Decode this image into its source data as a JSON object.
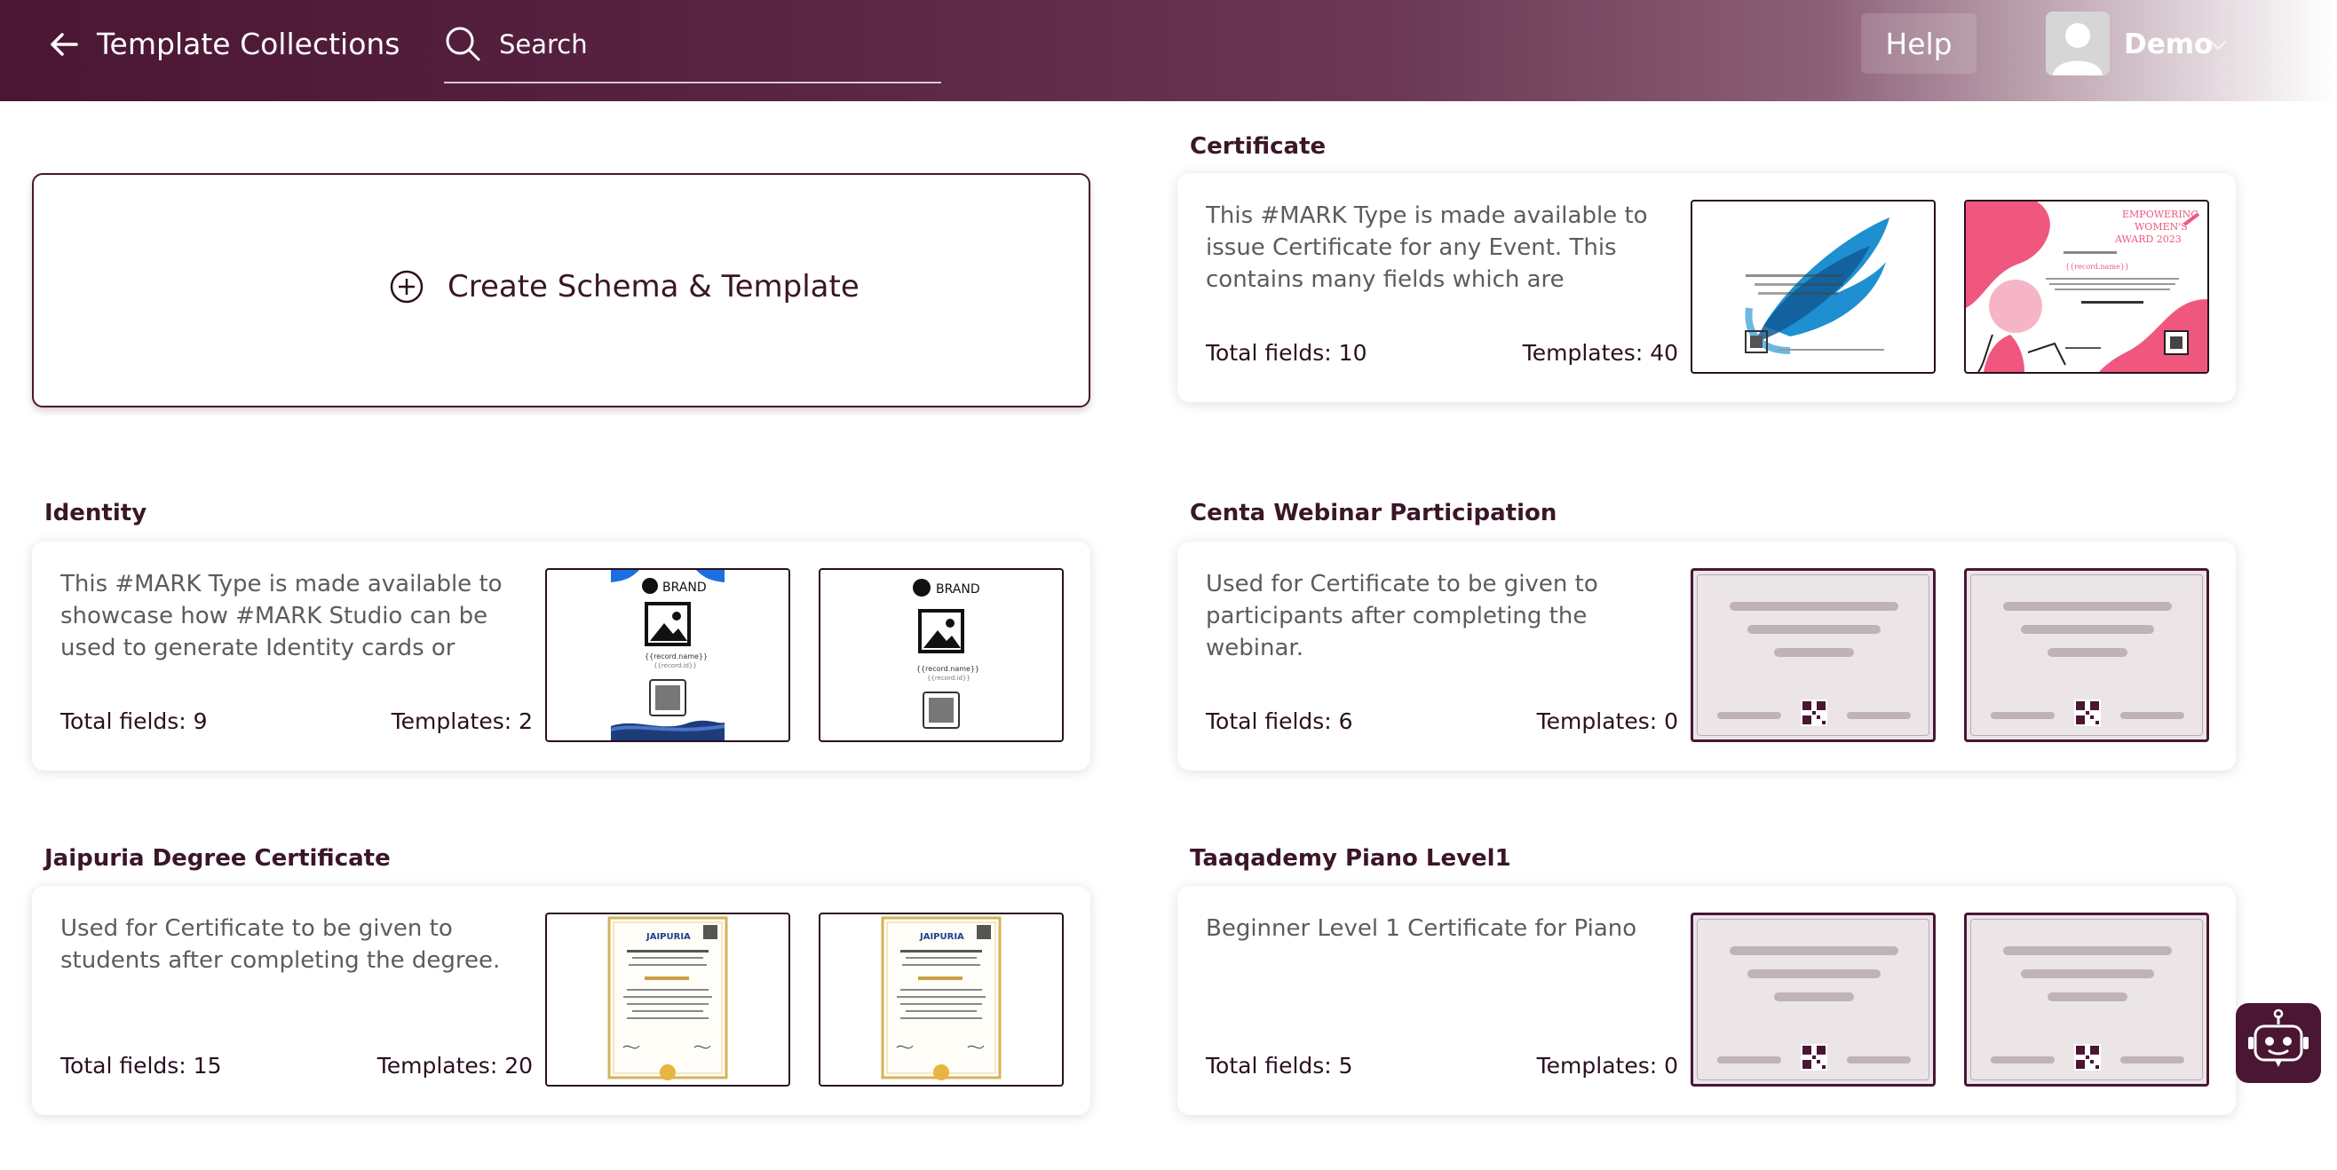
{
  "header": {
    "title": "Template Collections",
    "search_placeholder": "Search",
    "help_label": "Help",
    "user_name": "Demo"
  },
  "create": {
    "label": "Create Schema & Template"
  },
  "collections": [
    {
      "title": "Certificate",
      "description": "This #MARK Type is made available to issue Certificate for any Event. This contains many fields which are commonly",
      "fields": "Total fields: 10",
      "templates": "Templates: 40",
      "thumb_text": {
        "award_title": "EMPOWERING WOMEN'S AWARD 2023",
        "record_name": "{{record.name}}"
      }
    },
    {
      "title": "Identity",
      "description": "This #MARK Type is made available to showcase how #MARK Studio can be used to generate Identity cards or visiting",
      "fields": "Total fields: 9",
      "templates": "Templates: 2",
      "thumb_text": {
        "brand": "BRAND",
        "record_name": "{{record.name}}",
        "record_id": "{{record.id}}"
      }
    },
    {
      "title": "Centa Webinar Participation",
      "description": "Used for Certificate to be given to participants after completing the webinar.",
      "fields": "Total fields: 6",
      "templates": "Templates: 0"
    },
    {
      "title": "Jaipuria Degree Certificate",
      "description": "Used for Certificate to be given to students after completing the degree.",
      "fields": "Total fields: 15",
      "templates": "Templates: 20",
      "thumb_text": {
        "logo": "JAIPURIA"
      }
    },
    {
      "title": "Taaqademy Piano Level1",
      "description": "Beginner Level 1 Certificate for Piano",
      "fields": "Total fields: 5",
      "templates": "Templates: 0"
    }
  ],
  "colors": {
    "header_start": "#4a1633",
    "accent": "#4a1633",
    "placeholder_bg": "#ebe5e8",
    "pink": "#f0577f"
  }
}
